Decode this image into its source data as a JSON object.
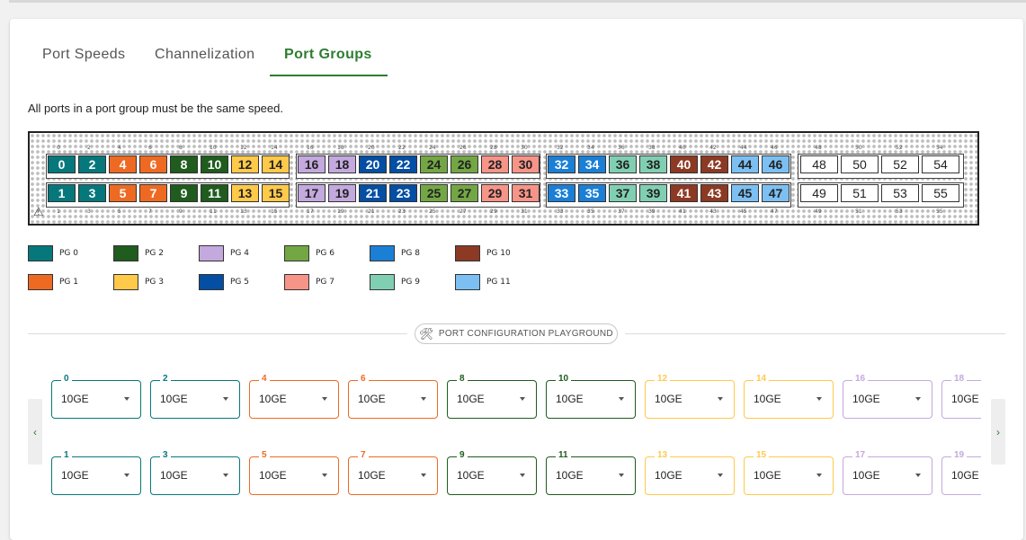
{
  "tabs": [
    {
      "label": "Port Speeds",
      "active": false
    },
    {
      "label": "Channelization",
      "active": false
    },
    {
      "label": "Port Groups",
      "active": true
    }
  ],
  "description": "All ports in a port group must be the same speed.",
  "colors": {
    "pg0": "#06787c",
    "pg1": "#ee6a23",
    "pg2": "#1f5c1e",
    "pg3": "#ffc94a",
    "pg4": "#c3a9de",
    "pg5": "#044ea3",
    "pg6": "#73a744",
    "pg7": "#f79488",
    "pg8": "#1b7fd6",
    "pg9": "#81cfb3",
    "pg10": "#8c3a24",
    "pg11": "#7cc0f3",
    "accent": "#2e7d32"
  },
  "switch": {
    "top_ports": [
      "0",
      "2",
      "4",
      "6",
      "8",
      "10",
      "12",
      "14",
      "16",
      "18",
      "20",
      "22",
      "24",
      "26",
      "28",
      "30",
      "32",
      "34",
      "36",
      "38",
      "40",
      "42",
      "44",
      "46"
    ],
    "bottom_ports": [
      "1",
      "3",
      "5",
      "7",
      "9",
      "11",
      "13",
      "15",
      "17",
      "19",
      "21",
      "23",
      "25",
      "27",
      "29",
      "31",
      "33",
      "35",
      "37",
      "39",
      "41",
      "43",
      "45",
      "47"
    ],
    "top_empty_ports": [
      "48",
      "50",
      "52",
      "54"
    ],
    "bottom_empty_ports": [
      "49",
      "51",
      "53",
      "55"
    ],
    "top_labels": [
      "0",
      "2",
      "4",
      "6",
      "8",
      "10",
      "12",
      "14",
      "16",
      "18",
      "20",
      "22",
      "24",
      "26",
      "28",
      "30",
      "32",
      "34",
      "36",
      "38",
      "40",
      "42",
      "44",
      "46",
      "48",
      "50",
      "52",
      "54"
    ],
    "bottom_labels": [
      "1",
      "3",
      "5",
      "7",
      "9",
      "11",
      "13",
      "15",
      "17",
      "19",
      "21",
      "23",
      "25",
      "27",
      "29",
      "31",
      "33",
      "35",
      "37",
      "39",
      "41",
      "43",
      "45",
      "47",
      "49",
      "51",
      "53",
      "55"
    ],
    "warning_icon": "warning-triangle-icon"
  },
  "legend": [
    {
      "label": "PG 0",
      "color": "#06787c"
    },
    {
      "label": "PG 1",
      "color": "#ee6a23"
    },
    {
      "label": "PG 2",
      "color": "#1f5c1e"
    },
    {
      "label": "PG 3",
      "color": "#ffc94a"
    },
    {
      "label": "PG 4",
      "color": "#c3a9de"
    },
    {
      "label": "PG 5",
      "color": "#044ea3"
    },
    {
      "label": "PG 6",
      "color": "#73a744"
    },
    {
      "label": "PG 7",
      "color": "#f79488"
    },
    {
      "label": "PG 8",
      "color": "#1b7fd6"
    },
    {
      "label": "PG 9",
      "color": "#81cfb3"
    },
    {
      "label": "PG 10",
      "color": "#8c3a24"
    },
    {
      "label": "PG 11",
      "color": "#7cc0f3"
    }
  ],
  "playground": {
    "title": "PORT CONFIGURATION PLAYGROUND",
    "icon": "tools-icon",
    "prev_icon": "chevron-left-icon",
    "next_icon": "chevron-right-icon",
    "top_selects": [
      {
        "port": "0",
        "value": "10GE"
      },
      {
        "port": "2",
        "value": "10GE"
      },
      {
        "port": "4",
        "value": "10GE"
      },
      {
        "port": "6",
        "value": "10GE"
      },
      {
        "port": "8",
        "value": "10GE"
      },
      {
        "port": "10",
        "value": "10GE"
      },
      {
        "port": "12",
        "value": "10GE"
      },
      {
        "port": "14",
        "value": "10GE"
      },
      {
        "port": "16",
        "value": "10GE"
      },
      {
        "port": "18",
        "value": "10GE"
      }
    ],
    "bottom_selects": [
      {
        "port": "1",
        "value": "10GE"
      },
      {
        "port": "3",
        "value": "10GE"
      },
      {
        "port": "5",
        "value": "10GE"
      },
      {
        "port": "7",
        "value": "10GE"
      },
      {
        "port": "9",
        "value": "10GE"
      },
      {
        "port": "11",
        "value": "10GE"
      },
      {
        "port": "13",
        "value": "10GE"
      },
      {
        "port": "15",
        "value": "10GE"
      },
      {
        "port": "17",
        "value": "10GE"
      },
      {
        "port": "19",
        "value": "10GE"
      }
    ]
  }
}
